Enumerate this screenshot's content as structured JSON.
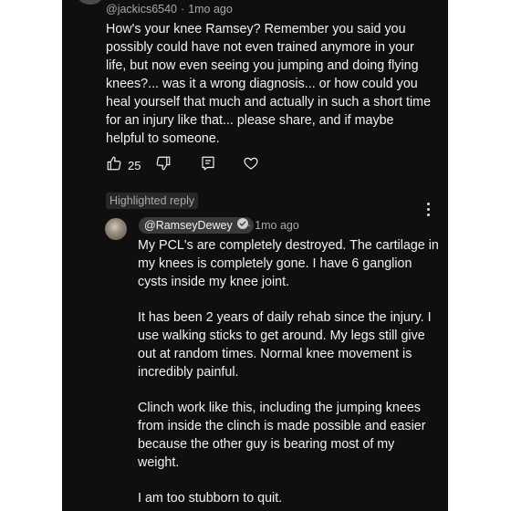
{
  "comment": {
    "author": "@jackics6540",
    "separator": "·",
    "time": "1mo ago",
    "text": "How's your knee Ramsey? Remember you said you possibly could have not even trained anymore in your life, but now even seeing you jumping and doing flying knees?... was it a wrong diagnosis... or how could you heal yourself that much and actually in such a short time for an injury like that... please share, and if maybe helpful to someone.",
    "actions": {
      "like_icon": "thumbs-up-icon",
      "like_count": "25",
      "dislike_icon": "thumbs-down-icon",
      "reply_icon": "reply-icon",
      "heart_icon": "heart-icon"
    }
  },
  "highlighted_label": "Highlighted reply",
  "more_icon": "more-vertical-icon",
  "reply": {
    "author": "@RamseyDewey",
    "verified_icon": "verified-check-icon",
    "separator": "·",
    "time": "1mo ago",
    "paragraphs": [
      "My PCL's are completely destroyed. The cartilage in my knees is completely gone. I have 6 ganglion cysts inside my knee joint.",
      "It has been 2 years of daily rehab since the injury. I use walking sticks to get around. My legs still give out at random times. Normal knee movement is incredibly painful.",
      "Clinch work like this, including the jumping knees from inside the clinch is made possible and easier because the other guy is bearing most of my weight.",
      "I am too stubborn to quit."
    ]
  },
  "colors": {
    "background": "#0f0f0f",
    "text": "#f1f1f1",
    "secondary_text": "#aaaaaa",
    "chip": "#3a3a3a",
    "badge": "#272727"
  }
}
